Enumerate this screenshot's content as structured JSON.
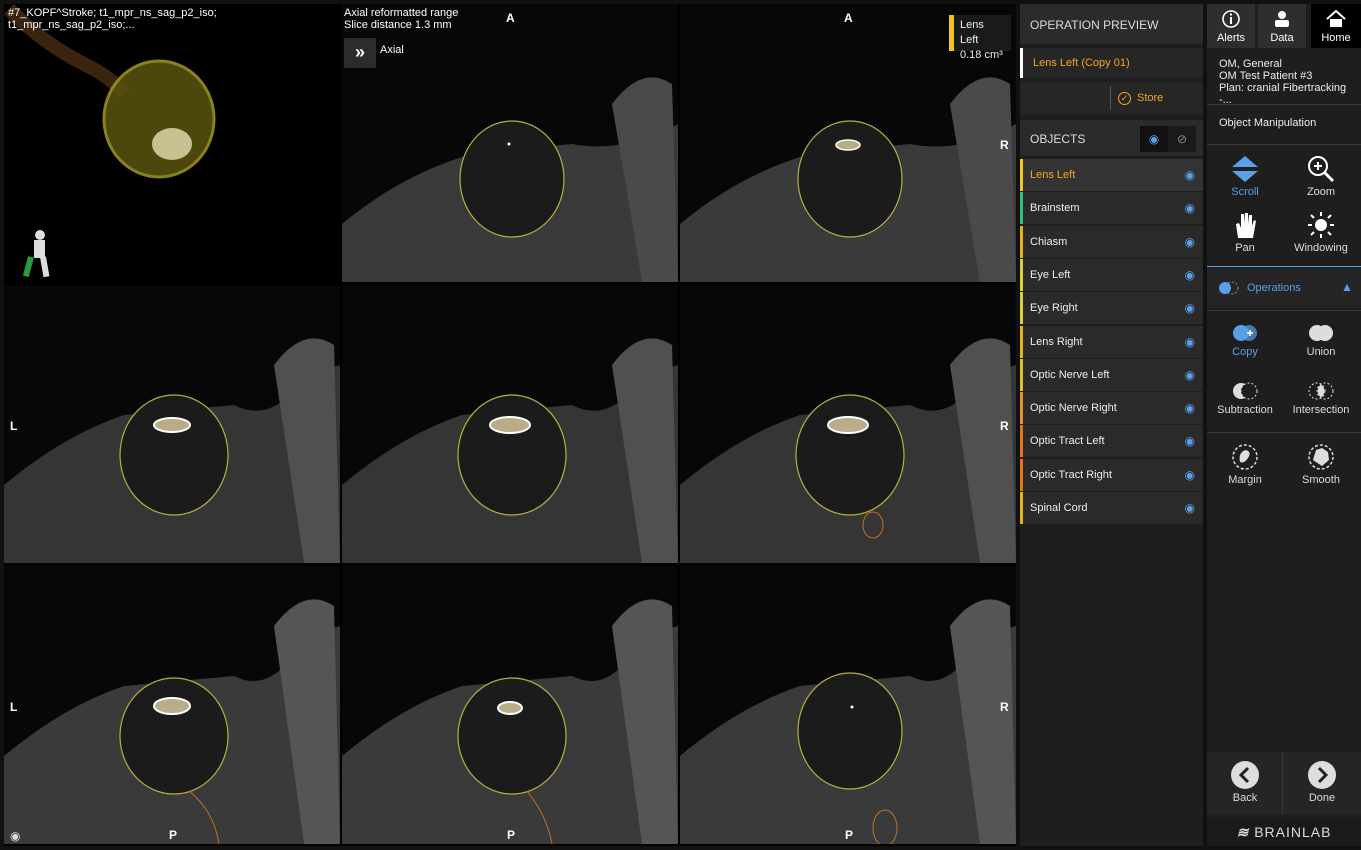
{
  "viewer": {
    "header_line1": "#7_KOPF^Stroke; t1_mpr_ns_sag_p2_iso; t1_mpr_ns_sag_p2_iso;...",
    "range_line1": "Axial reformatted range",
    "range_line2": "Slice distance 1.3 mm",
    "axial_label": "Axial",
    "lens_name": "Lens Left",
    "lens_volume": "0.18 cm³",
    "orient": {
      "A": "A",
      "L": "L",
      "R": "R",
      "P": "P"
    }
  },
  "operation_preview": {
    "title": "OPERATION PREVIEW",
    "item": "Lens Left (Copy 01)",
    "store_label": "Store"
  },
  "objects": {
    "title": "OBJECTS",
    "items": [
      {
        "label": "Lens Left",
        "color": "#f5c518",
        "active": true
      },
      {
        "label": "Brainstem",
        "color": "#2fc27a"
      },
      {
        "label": "Chiasm",
        "color": "#e8b020"
      },
      {
        "label": "Eye Left",
        "color": "#d8d040"
      },
      {
        "label": "Eye Right",
        "color": "#d8d040"
      },
      {
        "label": "Lens Right",
        "color": "#e8b020"
      },
      {
        "label": "Optic Nerve Left",
        "color": "#e0c030"
      },
      {
        "label": "Optic Nerve Right",
        "color": "#e89030"
      },
      {
        "label": "Optic Tract Left",
        "color": "#e87020"
      },
      {
        "label": "Optic Tract Right",
        "color": "#e87020"
      },
      {
        "label": "Spinal Cord",
        "color": "#e8b020"
      }
    ]
  },
  "nav": {
    "alerts": "Alerts",
    "data": "Data",
    "home": "Home"
  },
  "patient": {
    "line1": "OM, General",
    "line2": "OM Test Patient #3",
    "line3": "Plan: cranial Fibertracking -..."
  },
  "tools": {
    "title": "Object Manipulation",
    "scroll": "Scroll",
    "zoom": "Zoom",
    "pan": "Pan",
    "windowing": "Windowing"
  },
  "operations": {
    "title": "Operations",
    "copy": "Copy",
    "union": "Union",
    "subtraction": "Subtraction",
    "intersection": "Intersection",
    "margin": "Margin",
    "smooth": "Smooth"
  },
  "footer": {
    "back": "Back",
    "done": "Done",
    "brand": "BRAINLAB"
  },
  "colors": {
    "accent": "#f5a623",
    "selected_blue": "#5aa0e8"
  }
}
